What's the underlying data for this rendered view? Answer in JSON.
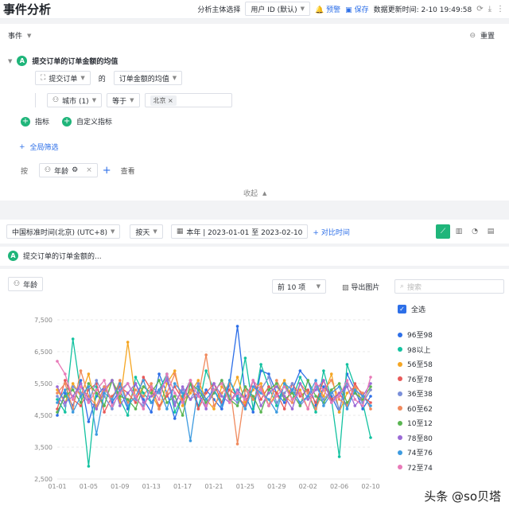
{
  "header": {
    "title": "事件分析",
    "subject_label": "分析主体选择",
    "subject_value": "用户 ID (默认)",
    "alert": "预警",
    "save": "保存",
    "updated": "数据更新时间: 2-10 19:49:58"
  },
  "panel": {
    "events_label": "事件",
    "reset": "重置",
    "metric_name": "提交订单的订单金额的均值",
    "event": "提交订单",
    "of": "的",
    "aggregation": "订单金额的均值",
    "filter_field": "城市 (1)",
    "filter_op": "等于",
    "filter_value": "北京",
    "add_metric": "指标",
    "add_custom_metric": "自定义指标",
    "global_filter": "全局筛选",
    "by": "按",
    "group_field": "年龄",
    "view": "查看",
    "collapse": "收起"
  },
  "toolbar": {
    "timezone": "中国标准时间(北京) (UTC+8)",
    "granularity": "按天",
    "date_range": "本年 | 2023-01-01 至 2023-02-10",
    "compare": "+ 对比时间"
  },
  "series_strip": {
    "label": "提交订单的订单金额的..."
  },
  "chart_header": {
    "group_btn": "年龄",
    "top_n": "前 10 项",
    "export": "导出图片",
    "search_placeholder": "搜索",
    "select_all": "全选"
  },
  "watermark": "头条 @so贝塔",
  "chart_data": {
    "type": "line",
    "ylim": [
      2500,
      7500
    ],
    "yticks": [
      "2,500",
      "3,500",
      "4,500",
      "5,500",
      "6,500",
      "7,500"
    ],
    "x": [
      "01-01",
      "01-02",
      "01-03",
      "01-04",
      "01-05",
      "01-06",
      "01-07",
      "01-08",
      "01-09",
      "01-10",
      "01-11",
      "01-12",
      "01-13",
      "01-14",
      "01-15",
      "01-16",
      "01-17",
      "01-18",
      "01-19",
      "01-20",
      "01-21",
      "01-22",
      "01-23",
      "01-24",
      "01-25",
      "01-26",
      "01-27",
      "01-28",
      "01-29",
      "01-30",
      "01-31",
      "02-01",
      "02-02",
      "02-03",
      "02-04",
      "02-05",
      "02-06",
      "02-07",
      "02-08",
      "02-09",
      "02-10"
    ],
    "xticks": [
      "01-01",
      "01-05",
      "01-09",
      "01-13",
      "01-17",
      "01-21",
      "01-25",
      "01-29",
      "02-02",
      "02-06",
      "02-10"
    ],
    "series": [
      {
        "name": "96至98",
        "color": "#2d6fe8",
        "values": [
          4500,
          5200,
          4800,
          5600,
          4300,
          5100,
          5400,
          4900,
          5300,
          4700,
          5500,
          5000,
          4600,
          5800,
          5200,
          4400,
          5100,
          5600,
          4800,
          5300,
          5000,
          4700,
          5500,
          7300,
          5100,
          4600,
          5900,
          5800,
          5200,
          4900,
          5300,
          5900,
          5600,
          4800,
          5400,
          5100,
          4600,
          5800,
          5300,
          4700,
          5100
        ]
      },
      {
        "name": "98以上",
        "color": "#13c2a0",
        "values": [
          5000,
          4600,
          6900,
          5200,
          2900,
          5400,
          4800,
          5600,
          5000,
          4500,
          5700,
          5200,
          4900,
          5300,
          5800,
          4600,
          5100,
          5500,
          4700,
          5900,
          5300,
          4900,
          5600,
          5000,
          6300,
          4700,
          6100,
          5400,
          4800,
          5500,
          5000,
          5700,
          5200,
          4600,
          5900,
          5000,
          3200,
          6100,
          5400,
          4900,
          3800
        ]
      },
      {
        "name": "56至58",
        "color": "#f5a623",
        "values": [
          5300,
          4900,
          5500,
          5100,
          5800,
          4700,
          5200,
          5600,
          4900,
          6800,
          5000,
          5400,
          5200,
          4700,
          5500,
          5900,
          4800,
          5200,
          5600,
          5000,
          4700,
          5400,
          5100,
          5700,
          4900,
          5300,
          5500,
          4800,
          5200,
          5600,
          5000,
          5300,
          4700,
          5500,
          5100,
          5800,
          4600,
          5200,
          5400,
          4900,
          5300
        ]
      },
      {
        "name": "76至78",
        "color": "#e85a5a",
        "values": [
          4700,
          5600,
          5000,
          4800,
          5300,
          5500,
          4600,
          5100,
          5400,
          5200,
          4900,
          5700,
          5300,
          4800,
          5100,
          5400,
          5000,
          5600,
          4700,
          5200,
          5500,
          4900,
          5300,
          5100,
          4800,
          5600,
          5000,
          5400,
          5200,
          4700,
          5500,
          5100,
          5300,
          4900,
          5600,
          5000,
          5200,
          4800,
          5500,
          5100,
          4900
        ]
      },
      {
        "name": "36至38",
        "color": "#7a8fd9",
        "values": [
          5100,
          4800,
          5400,
          5200,
          4900,
          5600,
          5100,
          4700,
          5300,
          5500,
          5000,
          4800,
          5400,
          5200,
          5700,
          4900,
          5300,
          5000,
          5500,
          4800,
          5200,
          5600,
          5100,
          4900,
          5400,
          5000,
          5300,
          5700,
          4900,
          5200,
          5500,
          4800,
          5100,
          5400,
          5000,
          5300,
          4700,
          5500,
          5200,
          4900,
          5300
        ]
      },
      {
        "name": "60至62",
        "color": "#f08a5d",
        "values": [
          5200,
          5500,
          4700,
          5900,
          5100,
          4800,
          5400,
          5000,
          5600,
          4900,
          5300,
          5100,
          5500,
          4700,
          5200,
          5800,
          4900,
          5300,
          5100,
          6400,
          4800,
          5200,
          5500,
          3600,
          5300,
          5000,
          5400,
          4800,
          5600,
          5100,
          4900,
          5500,
          5200,
          4700,
          5300,
          5600,
          5000,
          4800,
          5400,
          5200,
          4700
        ]
      },
      {
        "name": "10至12",
        "color": "#5ab552",
        "values": [
          4600,
          5100,
          5300,
          4900,
          5500,
          5200,
          4800,
          5600,
          5100,
          5000,
          4700,
          5400,
          5200,
          5600,
          4900,
          5100,
          4500,
          5500,
          5300,
          4900,
          5200,
          5600,
          5000,
          4800,
          5400,
          5100,
          4600,
          5300,
          5500,
          5000,
          5200,
          4800,
          5600,
          5100,
          4900,
          5300,
          5500,
          4900,
          5200,
          5000,
          5400
        ]
      },
      {
        "name": "78至80",
        "color": "#9b6ad6",
        "values": [
          5400,
          4900,
          5100,
          5500,
          5000,
          4700,
          5300,
          5600,
          4800,
          5200,
          5500,
          4900,
          5100,
          5300,
          5600,
          4800,
          5400,
          5000,
          5200,
          4700,
          5500,
          5100,
          4900,
          5300,
          5000,
          5600,
          4800,
          5200,
          5400,
          5100,
          4700,
          5500,
          5000,
          5300,
          5600,
          4900,
          5200,
          5400,
          4800,
          5100,
          5500
        ]
      },
      {
        "name": "74至76",
        "color": "#3d9be0",
        "values": [
          4900,
          5300,
          4600,
          5100,
          5400,
          3900,
          5200,
          5000,
          5500,
          4800,
          5100,
          5600,
          4900,
          5300,
          4700,
          5500,
          5200,
          3700,
          5400,
          5000,
          5300,
          4800,
          5600,
          5100,
          4700,
          5400,
          5200,
          5000,
          4600,
          5500,
          5300,
          4900,
          5100,
          5600,
          4800,
          5200,
          5400,
          4700,
          5300,
          5100,
          4800
        ]
      },
      {
        "name": "72至74",
        "color": "#e87ab8",
        "values": [
          6200,
          5800,
          5000,
          5400,
          4900,
          5300,
          5600,
          4800,
          5200,
          5500,
          5100,
          4700,
          5400,
          5000,
          5800,
          5200,
          4900,
          5600,
          5100,
          4800,
          5300,
          5500,
          4900,
          5200,
          5000,
          5600,
          5300,
          4800,
          5100,
          5400,
          5000,
          5200,
          4700,
          5500,
          5300,
          4900,
          5100,
          5600,
          5000,
          4800,
          5700
        ]
      }
    ]
  }
}
